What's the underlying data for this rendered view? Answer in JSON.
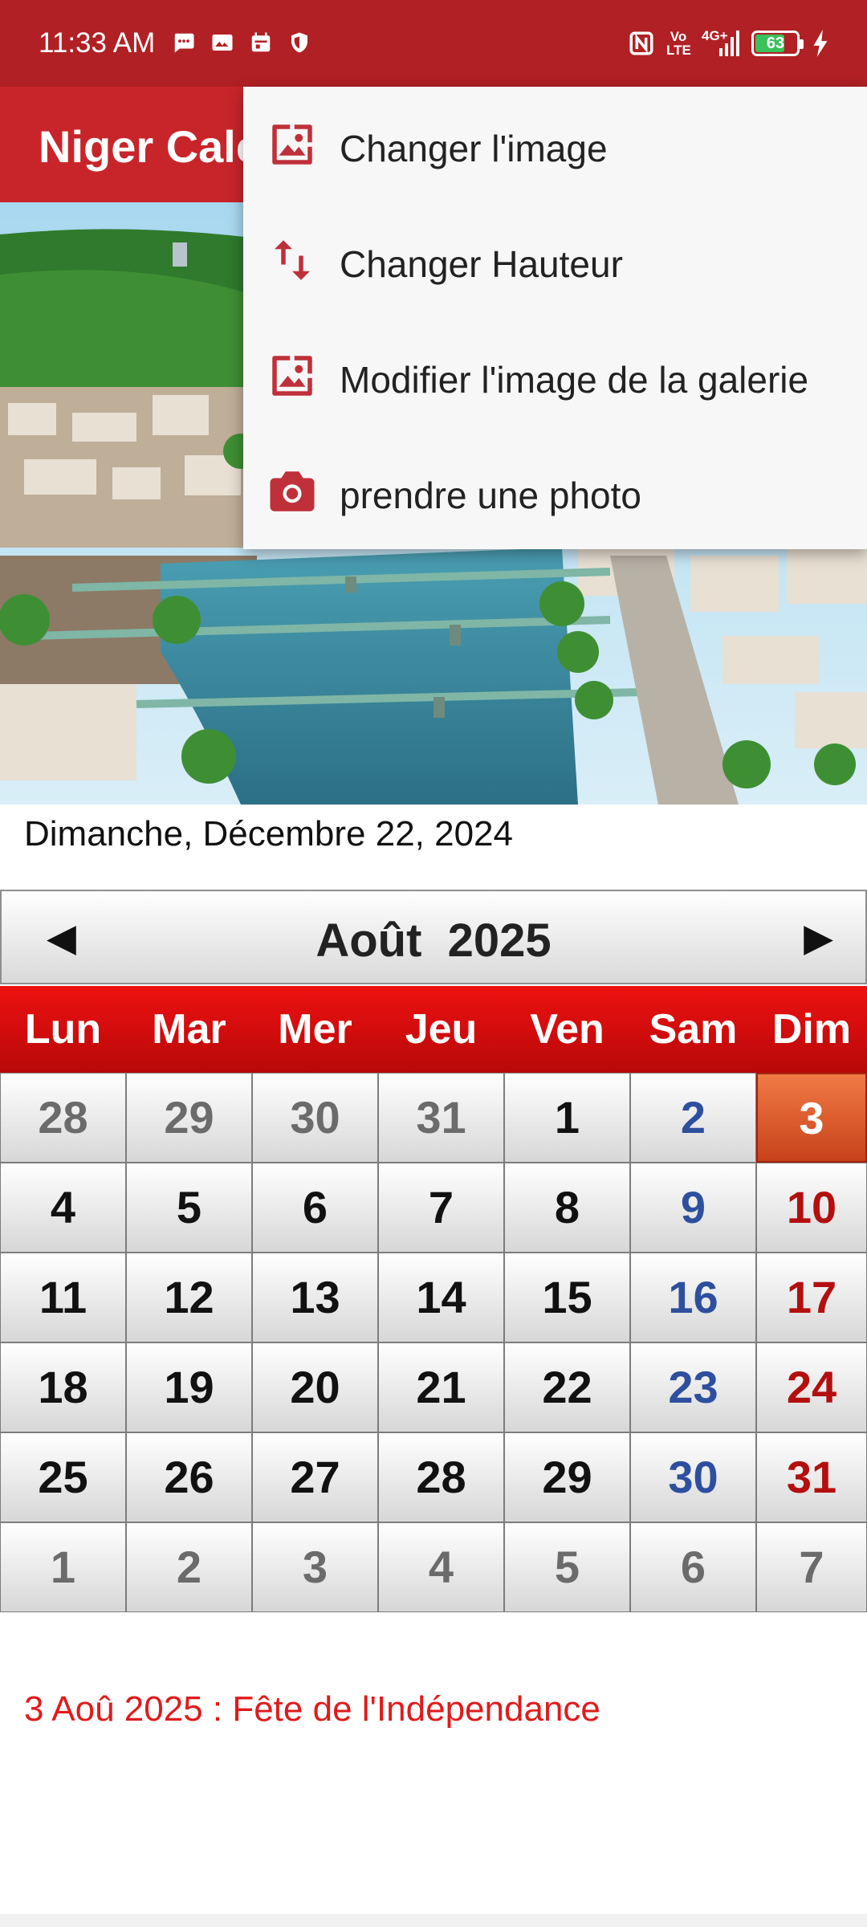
{
  "status_bar": {
    "time": "11:33 AM",
    "battery_level": "63",
    "network_label": "4G+",
    "volte_label": "Vo LTE"
  },
  "app_bar": {
    "title": "Niger Calendrier"
  },
  "current_date": "Dimanche, Décembre 22, 2024",
  "calendar": {
    "prev_symbol": "◀",
    "next_symbol": "▶",
    "month_label": "Août  2025",
    "weekdays": [
      "Lun",
      "Mar",
      "Mer",
      "Jeu",
      "Ven",
      "Sam",
      "Dim"
    ],
    "weeks": [
      [
        "28",
        "29",
        "30",
        "31",
        "1",
        "2",
        "3"
      ],
      [
        "4",
        "5",
        "6",
        "7",
        "8",
        "9",
        "10"
      ],
      [
        "11",
        "12",
        "13",
        "14",
        "15",
        "16",
        "17"
      ],
      [
        "18",
        "19",
        "20",
        "21",
        "22",
        "23",
        "24"
      ],
      [
        "25",
        "26",
        "27",
        "28",
        "29",
        "30",
        "31"
      ],
      [
        "1",
        "2",
        "3",
        "4",
        "5",
        "6",
        "7"
      ]
    ]
  },
  "holiday_text": "3 Aoû 2025 : Fête de l'Indépendance",
  "menu": {
    "items": [
      {
        "label": "Changer l'image",
        "icon": "image-icon"
      },
      {
        "label": "Changer Hauteur",
        "icon": "swap-vertical-icon"
      },
      {
        "label": "Modifier l'image de la galerie",
        "icon": "gallery-image-icon"
      },
      {
        "label": "prendre une photo",
        "icon": "camera-icon"
      }
    ]
  },
  "colors": {
    "status_bar": "#b02024",
    "app_bar": "#c8252a",
    "weekday_header": "#e00b0b",
    "today": "#e06030",
    "holiday_text": "#e01b1b",
    "saturday": "#2d4f9e",
    "sunday": "#b30f0f",
    "menu_icon": "#c0303a"
  }
}
